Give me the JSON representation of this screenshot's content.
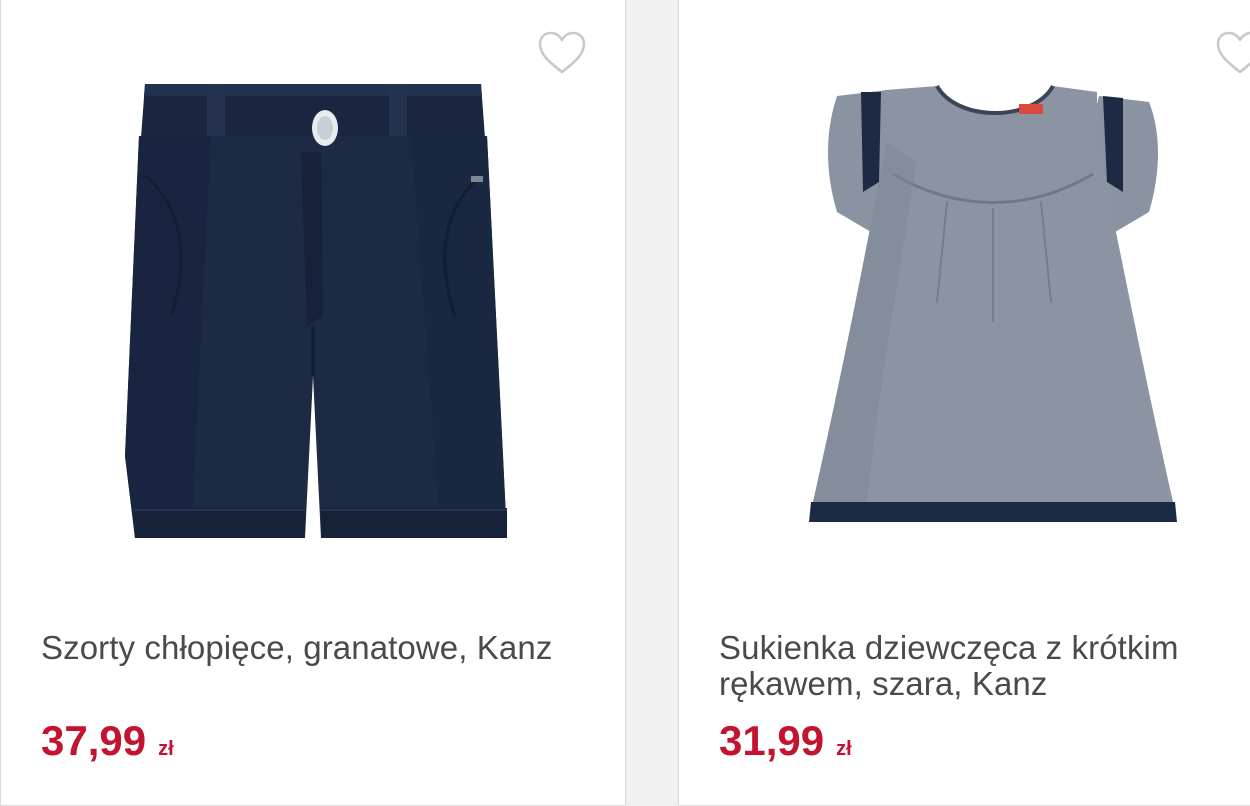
{
  "products": [
    {
      "title": "Szorty chłopięce, granatowe, Kanz",
      "price": "37,99",
      "currency": "zł",
      "image": "navy-shorts"
    },
    {
      "title": "Sukienka dziewczęca z krótkim rękawem, szara, Kanz",
      "price": "31,99",
      "currency": "zł",
      "image": "grey-dress"
    }
  ],
  "colors": {
    "price": "#c4132f",
    "title": "#4a4a4a",
    "heart_outline": "#c8c8c8",
    "shorts": "#1d2a44",
    "dress": "#8c94a3"
  },
  "icons": {
    "favorite": "heart-outline-icon"
  }
}
